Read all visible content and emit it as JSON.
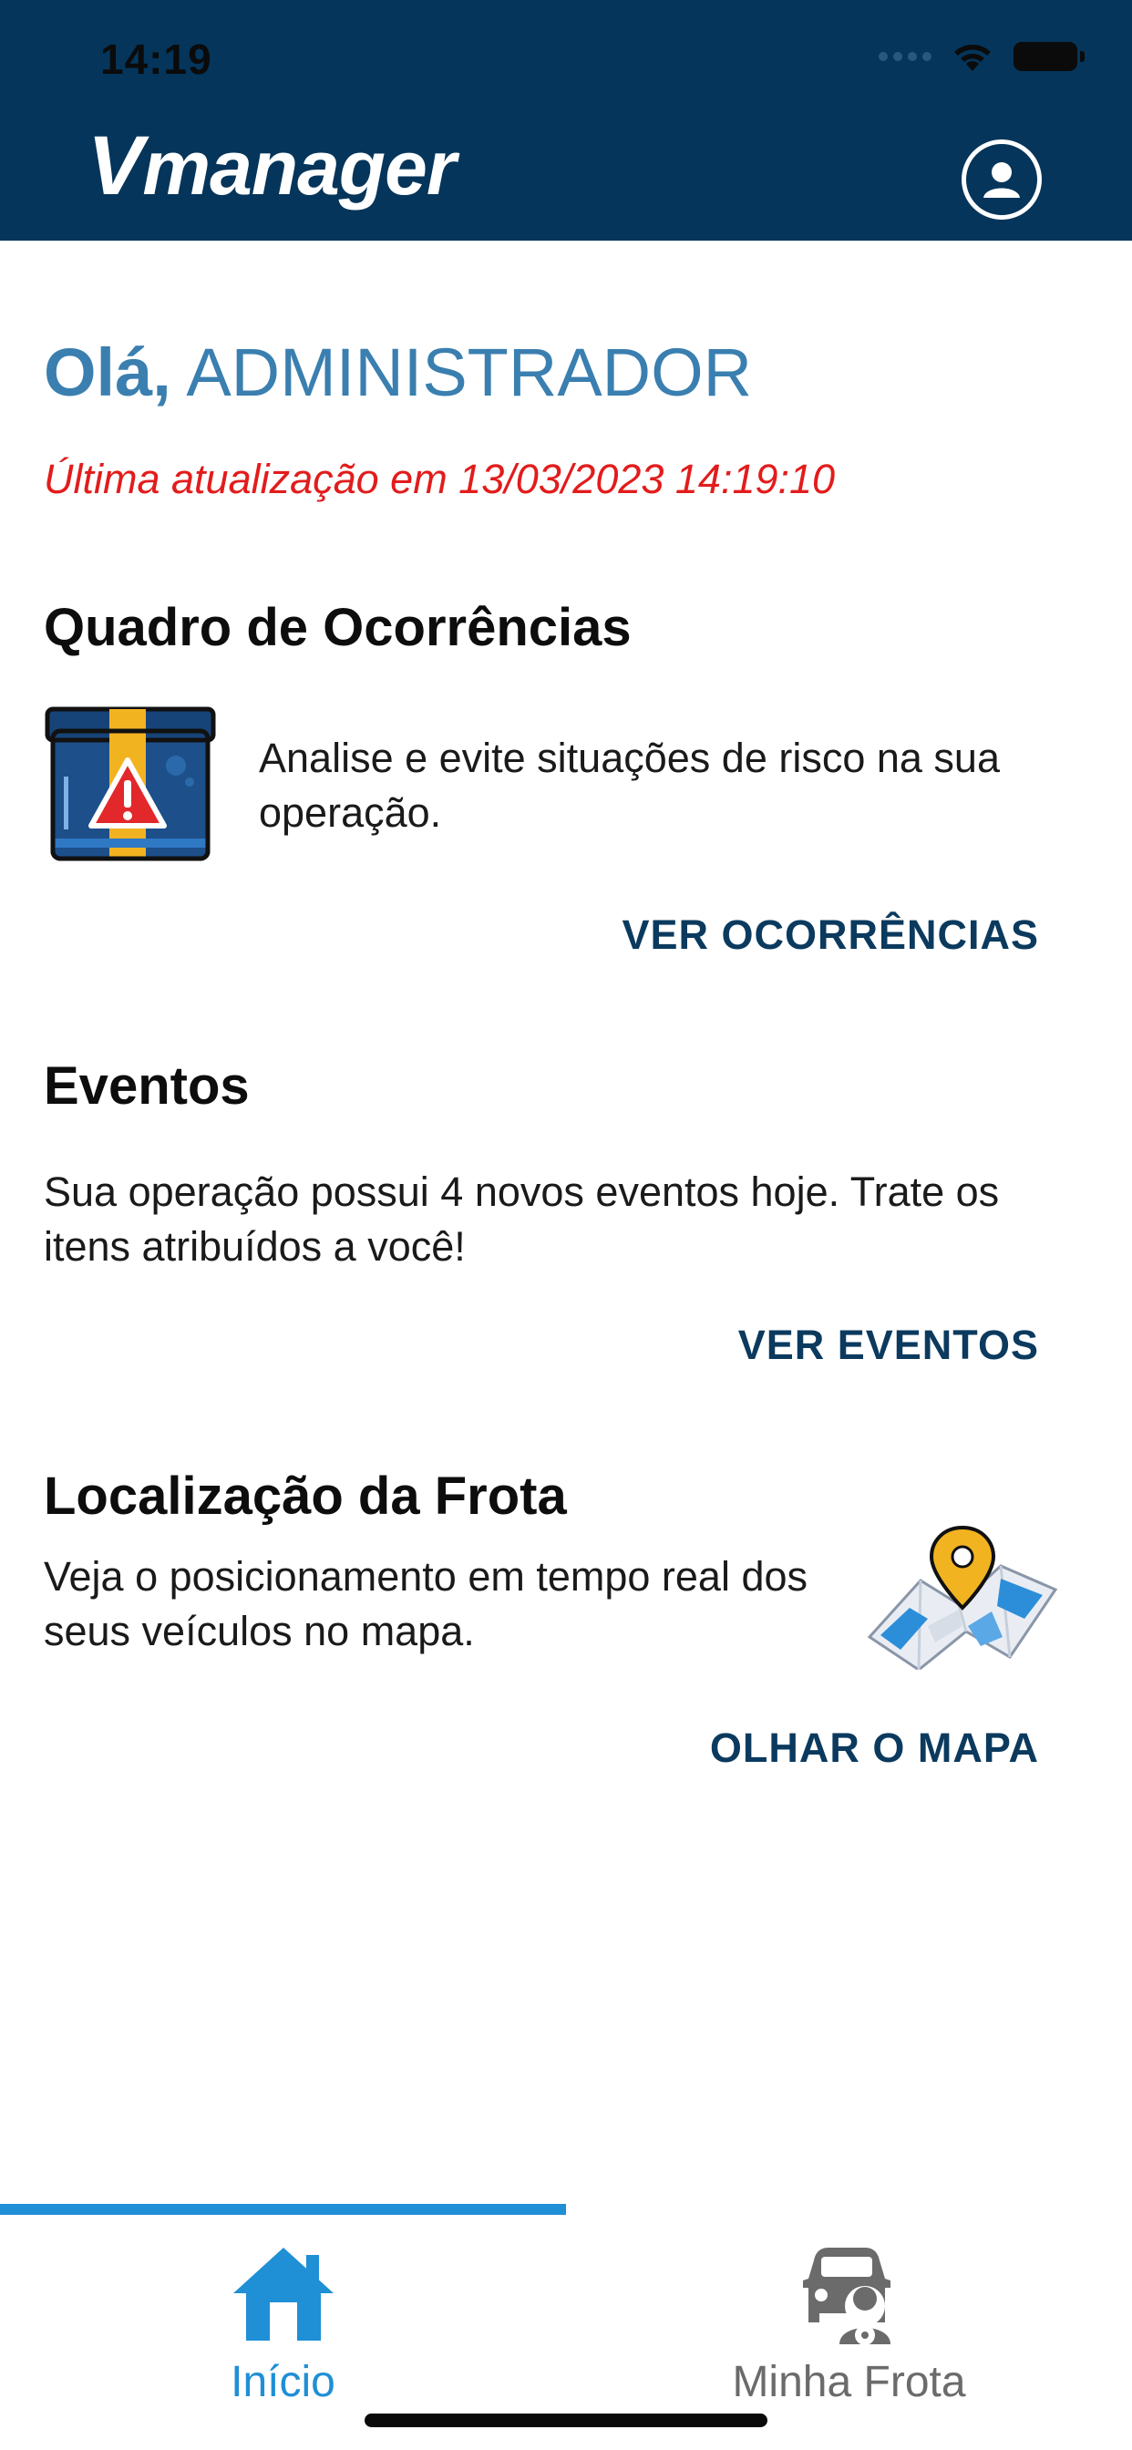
{
  "status_bar": {
    "time": "14:19"
  },
  "header": {
    "logo_v": "V",
    "logo_rest": "manager"
  },
  "greeting": {
    "hello": "Olá,",
    "name": "ADMINISTRADOR"
  },
  "last_update": "Última atualização em 13/03/2023 14:19:10",
  "occurrences": {
    "title": "Quadro de Ocorrências",
    "description": "Analise e evite situações de risco na sua operação.",
    "action": "VER OCORRÊNCIAS"
  },
  "events": {
    "title": "Eventos",
    "description": "Sua operação possui 4 novos eventos hoje. Trate os itens atribuídos a você!",
    "action": "VER EVENTOS"
  },
  "fleet_location": {
    "title": "Localização da Frota",
    "description": "Veja o posicionamento em tempo real dos seus veículos no mapa.",
    "action": "OLHAR O MAPA"
  },
  "tabs": [
    {
      "label": "Início",
      "icon": "home-icon",
      "active": true
    },
    {
      "label": "Minha Frota",
      "icon": "car-driver-icon",
      "active": false
    }
  ],
  "colors": {
    "header_bg": "#05355a",
    "greeting": "#3a7fb0",
    "alert_red": "#e21c1c",
    "link": "#0b3a5e",
    "tab_active": "#1f8fd6",
    "tab_inactive": "#6b6b6b"
  }
}
